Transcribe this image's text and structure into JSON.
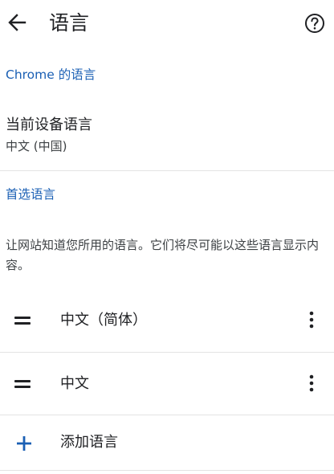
{
  "app": {
    "title": "语言",
    "back_icon": "arrow-back-icon",
    "help_icon": "help-circle-icon"
  },
  "colors": {
    "accent": "#1a5fb4",
    "text_primary": "#202124",
    "divider": "#e3e3e3"
  },
  "chrome_section": {
    "header": "Chrome 的语言"
  },
  "device_language": {
    "title": "当前设备语言",
    "value": "中文 (中国)"
  },
  "preferred_section": {
    "header": "首选语言",
    "description": "让网站知道您所用的语言。它们将尽可能以这些语言显示内容。"
  },
  "languages": [
    {
      "label": "中文（简体）",
      "handle_icon": "drag-handle-icon",
      "menu_icon": "more-vert-icon"
    },
    {
      "label": "中文",
      "handle_icon": "drag-handle-icon",
      "menu_icon": "more-vert-icon"
    }
  ],
  "add_language": {
    "label": "添加语言",
    "icon": "add-icon"
  }
}
